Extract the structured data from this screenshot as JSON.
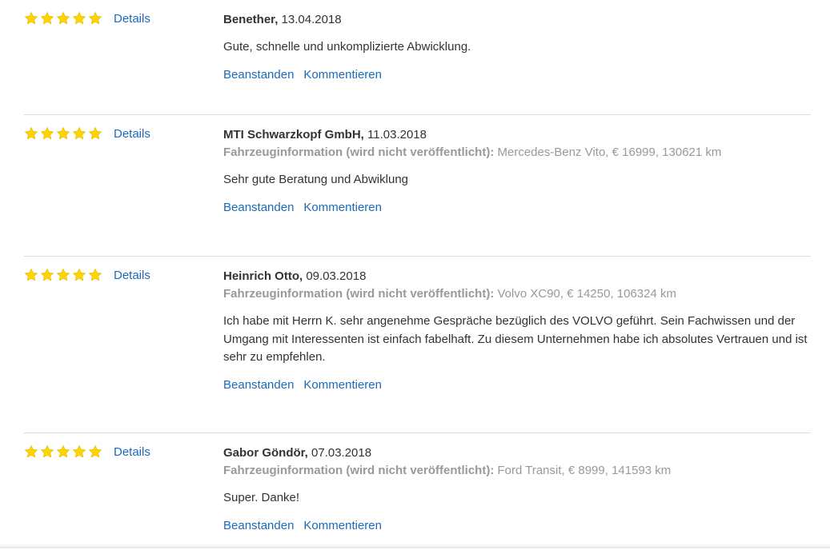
{
  "colors": {
    "star": "#ffd500",
    "star_stroke": "#e2b600",
    "link": "#1a6bb8",
    "text": "#333333",
    "muted": "#999999",
    "divider": "#dddddd"
  },
  "icons": {
    "rating_star": "star-icon"
  },
  "reviews": [
    {
      "rating": 5,
      "details_label": "Details",
      "author": "Benether,",
      "date": "13.04.2018",
      "vehicle_label": "",
      "vehicle_info": "",
      "comment": "Gute, schnelle und unkomplizierte Abwicklung.",
      "actions": {
        "report": "Beanstanden",
        "comment": "Kommentieren"
      }
    },
    {
      "rating": 5,
      "details_label": "Details",
      "author": "MTI Schwarzkopf GmbH,",
      "date": "11.03.2018",
      "vehicle_label": "Fahrzeuginformation (wird nicht veröffentlicht):",
      "vehicle_info": "Mercedes-Benz Vito, € 16999, 130621 km",
      "comment": "Sehr gute Beratung und Abwiklung",
      "actions": {
        "report": "Beanstanden",
        "comment": "Kommentieren"
      }
    },
    {
      "rating": 5,
      "details_label": "Details",
      "author": "Heinrich Otto,",
      "date": "09.03.2018",
      "vehicle_label": "Fahrzeuginformation (wird nicht veröffentlicht):",
      "vehicle_info": "Volvo XC90, € 14250, 106324 km",
      "comment": "Ich habe mit Herrn K. sehr angenehme Gespräche bezüglich des VOLVO geführt. Sein Fachwissen und der Umgang mit Interessenten ist einfach fabelhaft. Zu diesem Unternehmen habe ich absolutes Vertrauen und ist sehr zu empfehlen.",
      "actions": {
        "report": "Beanstanden",
        "comment": "Kommentieren"
      }
    },
    {
      "rating": 5,
      "details_label": "Details",
      "author": "Gabor Göndör,",
      "date": "07.03.2018",
      "vehicle_label": "Fahrzeuginformation (wird nicht veröffentlicht):",
      "vehicle_info": "Ford Transit, € 8999, 141593 km",
      "comment": "Super. Danke!",
      "actions": {
        "report": "Beanstanden",
        "comment": "Kommentieren"
      }
    }
  ]
}
